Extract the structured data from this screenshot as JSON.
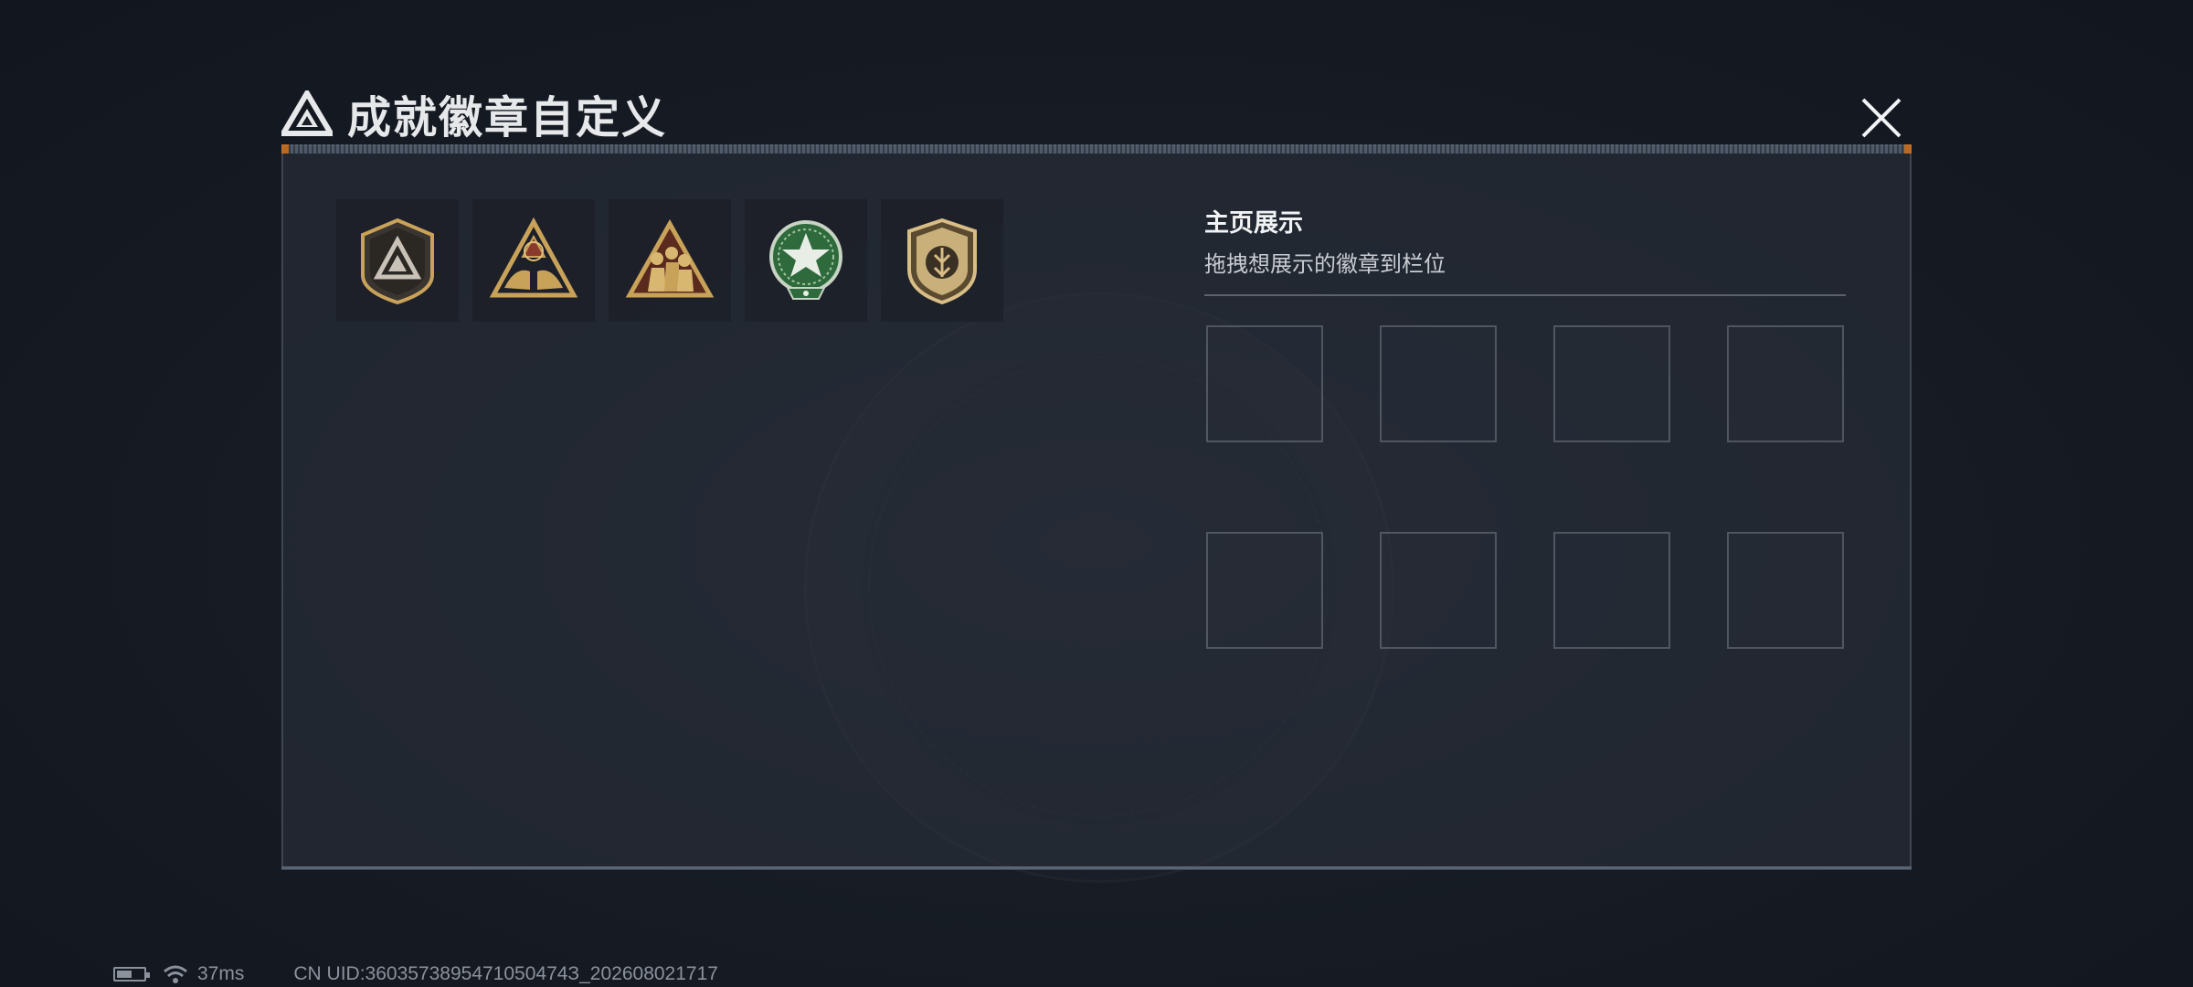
{
  "dialog": {
    "title": "成就徽章自定义",
    "title_icon": "triangle-logo-icon",
    "close_icon": "close-icon"
  },
  "owned_badges": [
    {
      "name": "shield-triangle-badge",
      "icon": "shield-triangle-icon"
    },
    {
      "name": "triangle-hands-badge",
      "icon": "triangle-hands-icon"
    },
    {
      "name": "triangle-soldiers-badge",
      "icon": "triangle-soldiers-icon"
    },
    {
      "name": "green-star-badge",
      "icon": "green-star-icon"
    },
    {
      "name": "gold-shield-badge",
      "icon": "gold-shield-icon"
    }
  ],
  "display": {
    "title": "主页展示",
    "subtitle": "拖拽想展示的徽章到栏位",
    "slot_count": 8
  },
  "status": {
    "ping": "37ms",
    "uid": "CN UID:3603573895471050474З_202608021717"
  },
  "colors": {
    "gold": "#c9a25a",
    "accent_orange": "#e07a1f",
    "green": "#3d7a4a"
  }
}
